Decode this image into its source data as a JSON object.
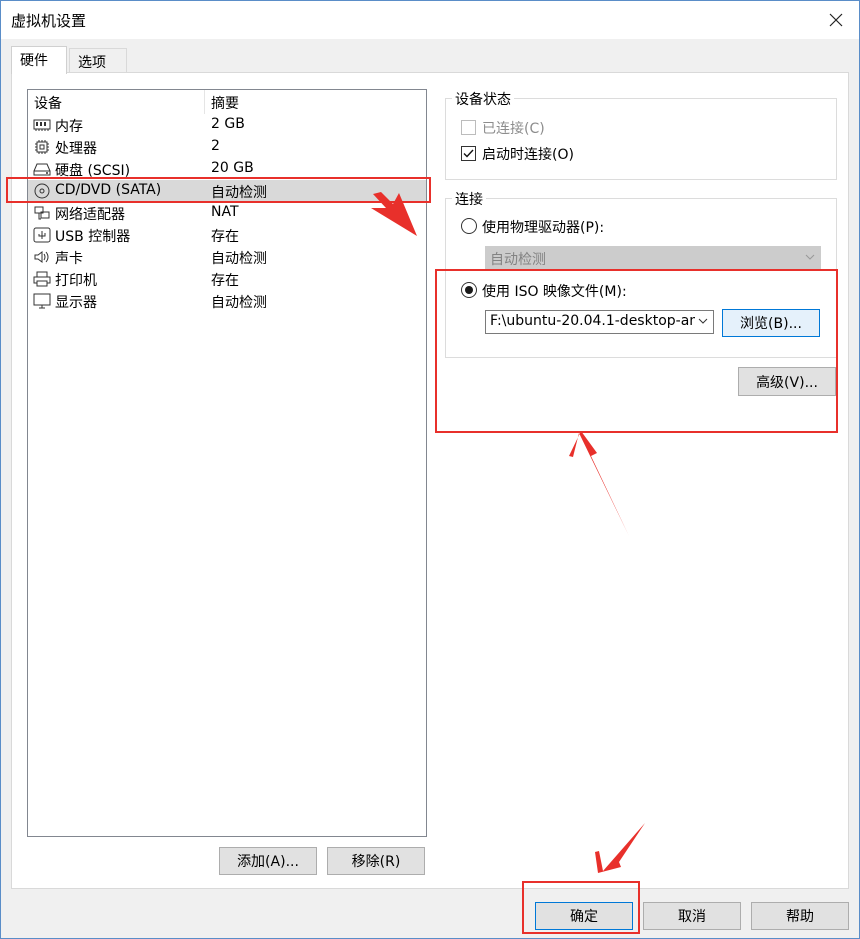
{
  "window": {
    "title": "虚拟机设置"
  },
  "tabs": [
    {
      "label": "硬件"
    },
    {
      "label": "选项"
    }
  ],
  "device_list": {
    "col_device": "设备",
    "col_summary": "摘要",
    "rows": [
      {
        "icon": "memory-icon",
        "name": "内存",
        "summary": "2 GB"
      },
      {
        "icon": "processor-icon",
        "name": "处理器",
        "summary": "2"
      },
      {
        "icon": "hard-disk-icon",
        "name": "硬盘 (SCSI)",
        "summary": "20 GB"
      },
      {
        "icon": "cd-dvd-icon",
        "name": "CD/DVD (SATA)",
        "summary": "自动检测"
      },
      {
        "icon": "network-adapter-icon",
        "name": "网络适配器",
        "summary": "NAT"
      },
      {
        "icon": "usb-icon",
        "name": "USB 控制器",
        "summary": "存在"
      },
      {
        "icon": "speaker-icon",
        "name": "声卡",
        "summary": "自动检测"
      },
      {
        "icon": "printer-icon",
        "name": "打印机",
        "summary": "存在"
      },
      {
        "icon": "monitor-icon",
        "name": "显示器",
        "summary": "自动检测"
      }
    ],
    "selected_index": 3
  },
  "left_buttons": {
    "add": "添加(A)...",
    "remove": "移除(R)"
  },
  "device_status": {
    "title": "设备状态",
    "connected": {
      "label": "已连接(C)",
      "checked": false,
      "disabled": true
    },
    "connect_at_power_on": {
      "label": "启动时连接(O)",
      "checked": true
    }
  },
  "connection": {
    "title": "连接",
    "physical": {
      "label": "使用物理驱动器(P):",
      "selected": false,
      "combo_value": "自动检测"
    },
    "iso": {
      "label": "使用 ISO 映像文件(M):",
      "selected": true,
      "path": "F:\\ubuntu-20.04.1-desktop-am",
      "browse": "浏览(B)..."
    },
    "advanced": "高级(V)..."
  },
  "footer": {
    "ok": "确定",
    "cancel": "取消",
    "help": "帮助"
  },
  "colors": {
    "annotation": "#e8302b",
    "selected_row": "#d9d9d9",
    "window_bg": "#f0f0f0"
  }
}
